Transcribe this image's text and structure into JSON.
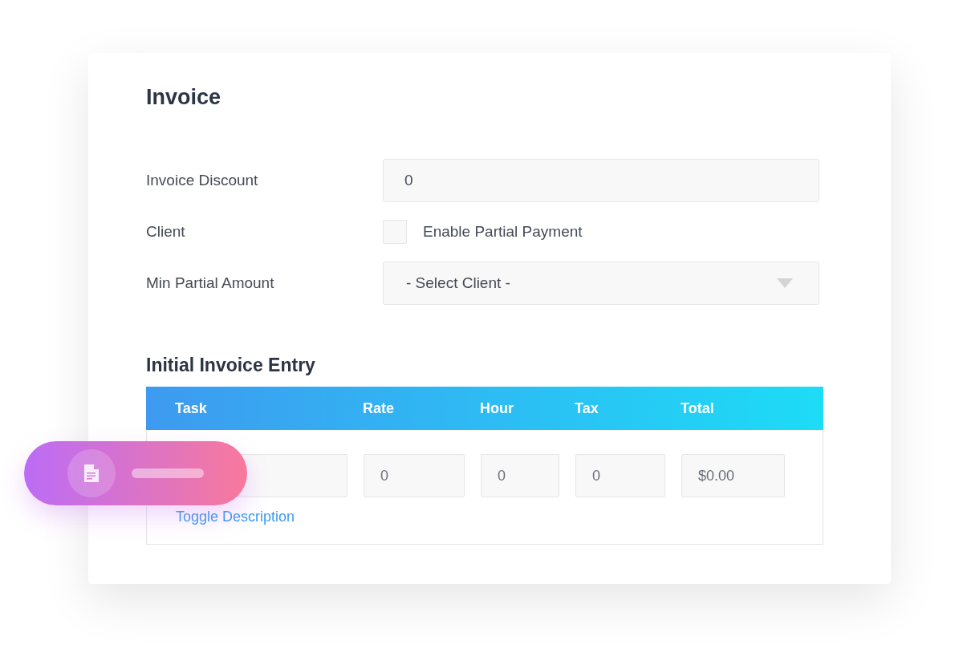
{
  "title": "Invoice",
  "fields": [
    {
      "kind": "input",
      "label": "Invoice Discount",
      "value": "0"
    },
    {
      "kind": "checkbox",
      "label": "Client",
      "checkbox_label": "Enable Partial Payment",
      "checked": false
    },
    {
      "kind": "select",
      "label": "Min Partial Amount",
      "value": "- Select Client -"
    }
  ],
  "entry_title": "Initial Invoice Entry",
  "table": {
    "columns": [
      "Task",
      "Rate",
      "Hour",
      "Tax",
      "Total"
    ],
    "rows": [
      {
        "cells": [
          {},
          {
            "value": "0"
          },
          {
            "value": "0"
          },
          {
            "value": "0"
          },
          {
            "value": "$0.00"
          }
        ]
      }
    ],
    "link": "Toggle Description"
  }
}
